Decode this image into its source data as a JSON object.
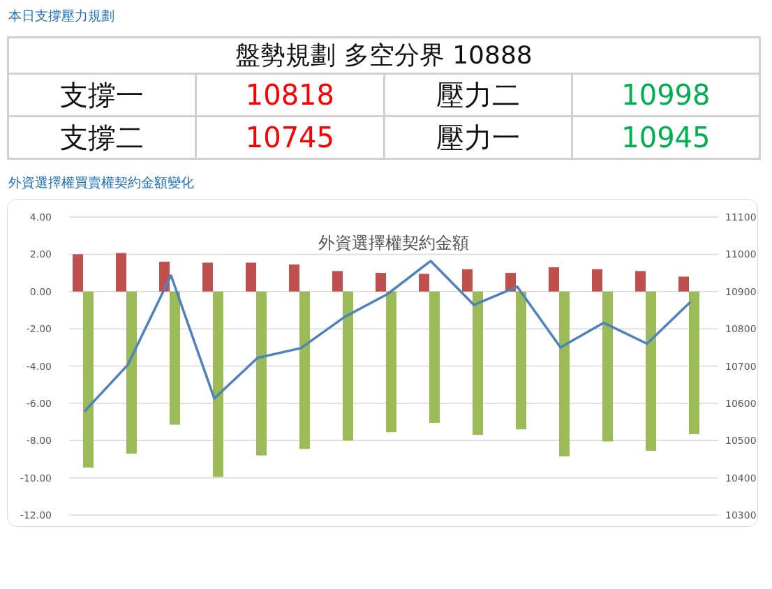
{
  "plan_heading": "本日支撐壓力規劃",
  "plan_table": {
    "title": "盤勢規劃 多空分界 10888",
    "rows": [
      {
        "cells": [
          {
            "kind": "label",
            "text": "支撐一"
          },
          {
            "kind": "support",
            "text": "10818"
          },
          {
            "kind": "label",
            "text": "壓力二"
          },
          {
            "kind": "resistance",
            "text": "10998"
          }
        ]
      },
      {
        "cells": [
          {
            "kind": "label",
            "text": "支撐二"
          },
          {
            "kind": "support",
            "text": "10745"
          },
          {
            "kind": "label",
            "text": "壓力一"
          },
          {
            "kind": "resistance",
            "text": "10945"
          }
        ]
      }
    ]
  },
  "chart_heading": "外資選擇權買賣權契約金額變化",
  "chart": {
    "chart_data": {
      "type": "bar",
      "title": "外資選擇權契約金額",
      "series": [
        {
          "color": "#c0504d",
          "values": [
            2.0,
            2.07,
            1.6,
            1.55,
            1.55,
            1.45,
            1.1,
            1.0,
            0.95,
            1.2,
            1.0,
            1.3,
            1.2,
            1.1,
            0.8
          ]
        },
        {
          "color": "#9bbb59",
          "values": [
            -9.45,
            -8.7,
            -7.15,
            -9.95,
            -8.8,
            -8.45,
            -8.0,
            -7.55,
            -7.05,
            -7.7,
            -7.4,
            -8.85,
            -8.05,
            -8.55,
            -7.65
          ]
        },
        {
          "type": "line",
          "axis": "y2",
          "color": "#4f81bd",
          "values": [
            10578,
            10703,
            10943,
            10613,
            10722,
            10748,
            10831,
            10893,
            10982,
            10864,
            10913,
            10750,
            10816,
            10760,
            10872
          ]
        }
      ],
      "grid": true,
      "ylim": [
        -12,
        4
      ],
      "yticks": [
        {
          "value": 4,
          "label": "4.00"
        },
        {
          "value": 2,
          "label": "2.00"
        },
        {
          "value": 0,
          "label": "0.00"
        },
        {
          "value": -2,
          "label": "-2.00"
        },
        {
          "value": -4,
          "label": "-4.00"
        },
        {
          "value": -6,
          "label": "-6.00"
        },
        {
          "value": -8,
          "label": "-8.00"
        },
        {
          "value": -10,
          "label": "-10.00"
        },
        {
          "value": -12,
          "label": "-12.00"
        }
      ],
      "y2lim": [
        10300,
        11100
      ],
      "y2ticks": [
        11100,
        11000,
        10900,
        10800,
        10700,
        10600,
        10500,
        10400,
        10300
      ]
    }
  }
}
